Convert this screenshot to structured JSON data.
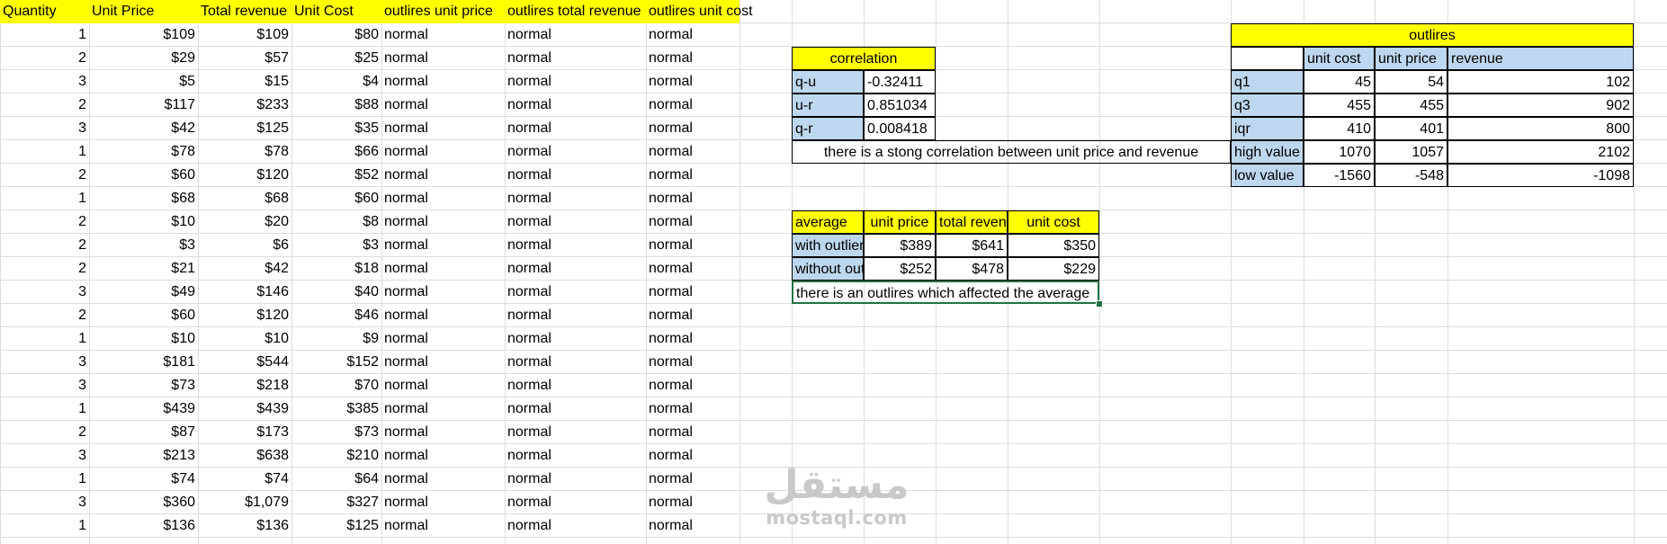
{
  "main_table": {
    "headers": [
      "Quantity",
      "Unit Price",
      "Total revenue",
      "Unit Cost",
      "outlires unit price",
      "outlires total revenue",
      "outlires unit cost"
    ],
    "rows": [
      [
        "1",
        "$109",
        "$109",
        "$80",
        "normal",
        "normal",
        "normal"
      ],
      [
        "2",
        "$29",
        "$57",
        "$25",
        "normal",
        "normal",
        "normal"
      ],
      [
        "3",
        "$5",
        "$15",
        "$4",
        "normal",
        "normal",
        "normal"
      ],
      [
        "2",
        "$117",
        "$233",
        "$88",
        "normal",
        "normal",
        "normal"
      ],
      [
        "3",
        "$42",
        "$125",
        "$35",
        "normal",
        "normal",
        "normal"
      ],
      [
        "1",
        "$78",
        "$78",
        "$66",
        "normal",
        "normal",
        "normal"
      ],
      [
        "2",
        "$60",
        "$120",
        "$52",
        "normal",
        "normal",
        "normal"
      ],
      [
        "1",
        "$68",
        "$68",
        "$60",
        "normal",
        "normal",
        "normal"
      ],
      [
        "2",
        "$10",
        "$20",
        "$8",
        "normal",
        "normal",
        "normal"
      ],
      [
        "2",
        "$3",
        "$6",
        "$3",
        "normal",
        "normal",
        "normal"
      ],
      [
        "2",
        "$21",
        "$42",
        "$18",
        "normal",
        "normal",
        "normal"
      ],
      [
        "3",
        "$49",
        "$146",
        "$40",
        "normal",
        "normal",
        "normal"
      ],
      [
        "2",
        "$60",
        "$120",
        "$46",
        "normal",
        "normal",
        "normal"
      ],
      [
        "1",
        "$10",
        "$10",
        "$9",
        "normal",
        "normal",
        "normal"
      ],
      [
        "3",
        "$181",
        "$544",
        "$152",
        "normal",
        "normal",
        "normal"
      ],
      [
        "3",
        "$73",
        "$218",
        "$70",
        "normal",
        "normal",
        "normal"
      ],
      [
        "1",
        "$439",
        "$439",
        "$385",
        "normal",
        "normal",
        "normal"
      ],
      [
        "2",
        "$87",
        "$173",
        "$73",
        "normal",
        "normal",
        "normal"
      ],
      [
        "3",
        "$213",
        "$638",
        "$210",
        "normal",
        "normal",
        "normal"
      ],
      [
        "1",
        "$74",
        "$74",
        "$64",
        "normal",
        "normal",
        "normal"
      ],
      [
        "3",
        "$360",
        "$1,079",
        "$327",
        "normal",
        "normal",
        "normal"
      ],
      [
        "1",
        "$136",
        "$136",
        "$125",
        "normal",
        "normal",
        "normal"
      ]
    ]
  },
  "correlation": {
    "title": "correlation",
    "rows": [
      {
        "label": "q-u",
        "value": "-0.32411"
      },
      {
        "label": "u-r",
        "value": "0.851034"
      },
      {
        "label": "q-r",
        "value": "0.008418"
      }
    ],
    "note": "there is a stong correlation between unit price and revenue"
  },
  "average": {
    "headers": [
      "average",
      "unit price",
      "total revenue",
      "unit cost"
    ],
    "rows": [
      {
        "label": "with outliers",
        "values": [
          "$389",
          "$641",
          "$350"
        ]
      },
      {
        "label": "without outliers",
        "values": [
          "$252",
          "$478",
          "$229"
        ]
      }
    ],
    "note": "there is an outlires which affected the average"
  },
  "outliers": {
    "title": "outlires",
    "columns": [
      "unit cost",
      "unit price",
      "revenue"
    ],
    "rows": [
      {
        "label": "q1",
        "values": [
          "45",
          "54",
          "102"
        ]
      },
      {
        "label": "q3",
        "values": [
          "455",
          "455",
          "902"
        ]
      },
      {
        "label": "iqr",
        "values": [
          "410",
          "401",
          "800"
        ]
      },
      {
        "label": "high value",
        "values": [
          "1070",
          "1057",
          "2102"
        ]
      },
      {
        "label": "low value",
        "values": [
          "-1560",
          "-548",
          "-1098"
        ]
      }
    ]
  },
  "watermark": {
    "arabic": "مستقل",
    "latin": "mostaql.com"
  },
  "colors": {
    "header_yellow": "#ffff00",
    "label_blue": "#bdd7ee",
    "gridline": "#dadcdf",
    "selection": "#217346"
  }
}
